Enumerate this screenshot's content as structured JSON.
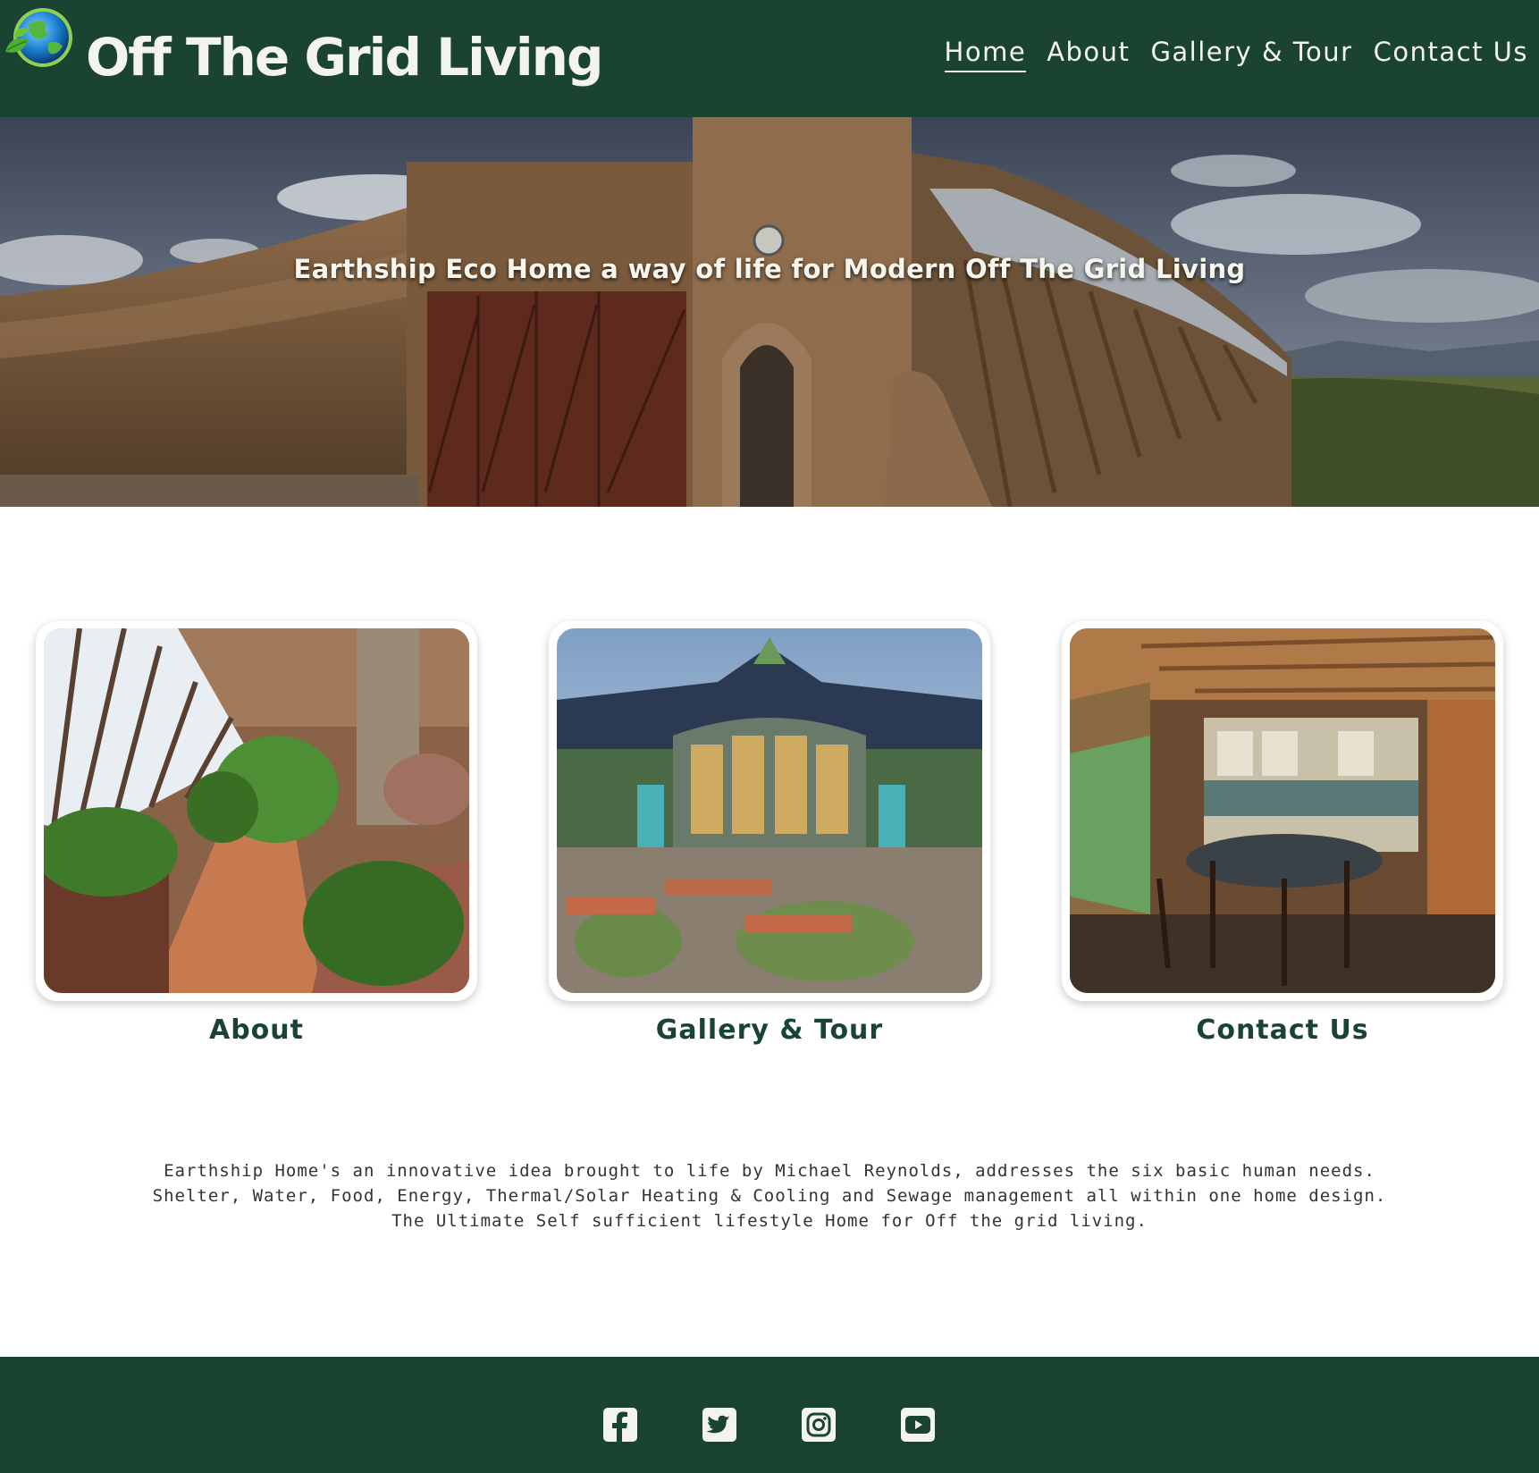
{
  "header": {
    "site_title": "Off The Grid Living",
    "logo_icon": "globe-leaf-icon",
    "nav": [
      {
        "label": "Home",
        "active": true
      },
      {
        "label": "About",
        "active": false
      },
      {
        "label": "Gallery & Tour",
        "active": false
      },
      {
        "label": "Contact Us",
        "active": false
      }
    ]
  },
  "hero": {
    "headline": "Earthship Eco Home a way of life for Modern Off The Grid Living"
  },
  "cards": [
    {
      "label": "About",
      "image": "earthship-greenhouse-corridor"
    },
    {
      "label": "Gallery & Tour",
      "image": "earthship-glass-dome-exterior"
    },
    {
      "label": "Contact Us",
      "image": "earthship-kitchen-dining"
    }
  ],
  "description": {
    "lines": [
      "Earthship Home's an innovative idea brought to life by Michael Reynolds, addresses the six basic human needs.",
      "Shelter, Water, Food, Energy, Thermal/Solar Heating & Cooling and Sewage management all within one home design.",
      "The Ultimate Self sufficient lifestyle Home for Off the grid living."
    ]
  },
  "footer": {
    "social": [
      "facebook-icon",
      "twitter-icon",
      "instagram-icon",
      "youtube-icon"
    ]
  },
  "colors": {
    "brand_green": "#1b4332",
    "header_text": "#f4f4ef",
    "body_text": "#333333",
    "background": "#ffffff"
  }
}
